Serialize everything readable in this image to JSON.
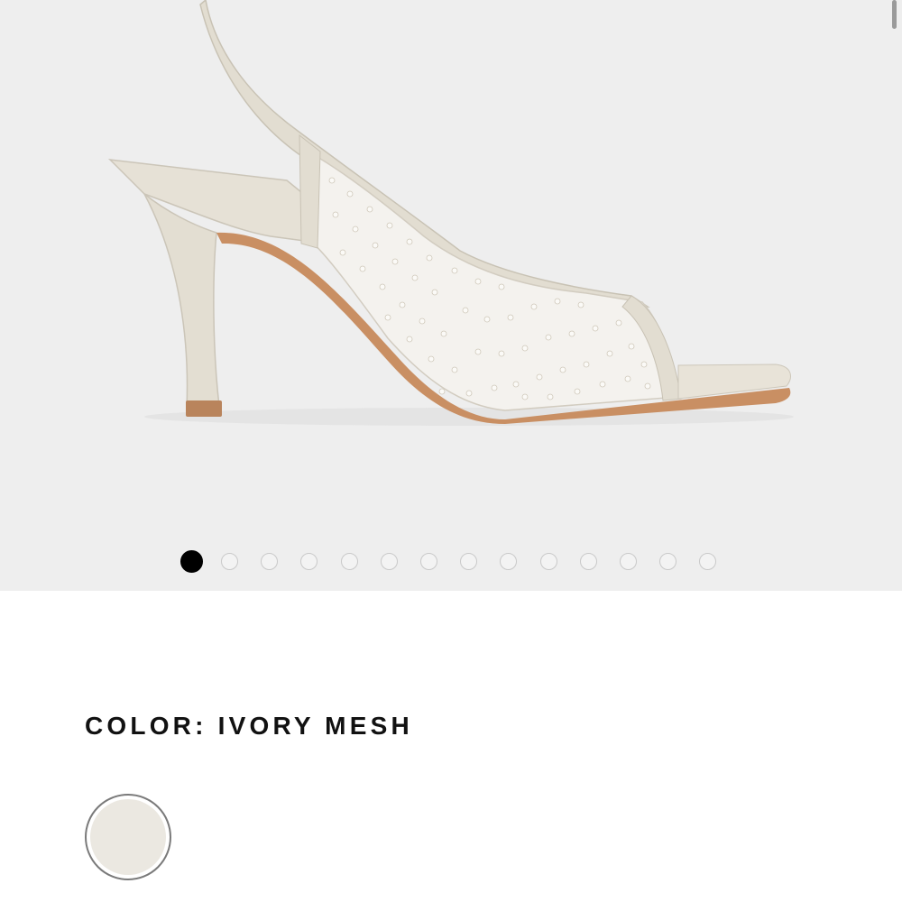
{
  "gallery": {
    "product_image_alt": "Ivory mesh slingback heel with pearl embellishments",
    "slide_count": 14,
    "active_slide": 0
  },
  "product": {
    "color_label": "COLOR: IVORY MESH"
  },
  "swatches": [
    {
      "name": "Ivory Mesh",
      "color": "#ebe8e1",
      "selected": true
    }
  ],
  "colors": {
    "gallery_bg": "#eeeeee",
    "shoe_ivory": "#e6e1d6",
    "sole_tan": "#c98f63",
    "active_dot": "#000000"
  }
}
